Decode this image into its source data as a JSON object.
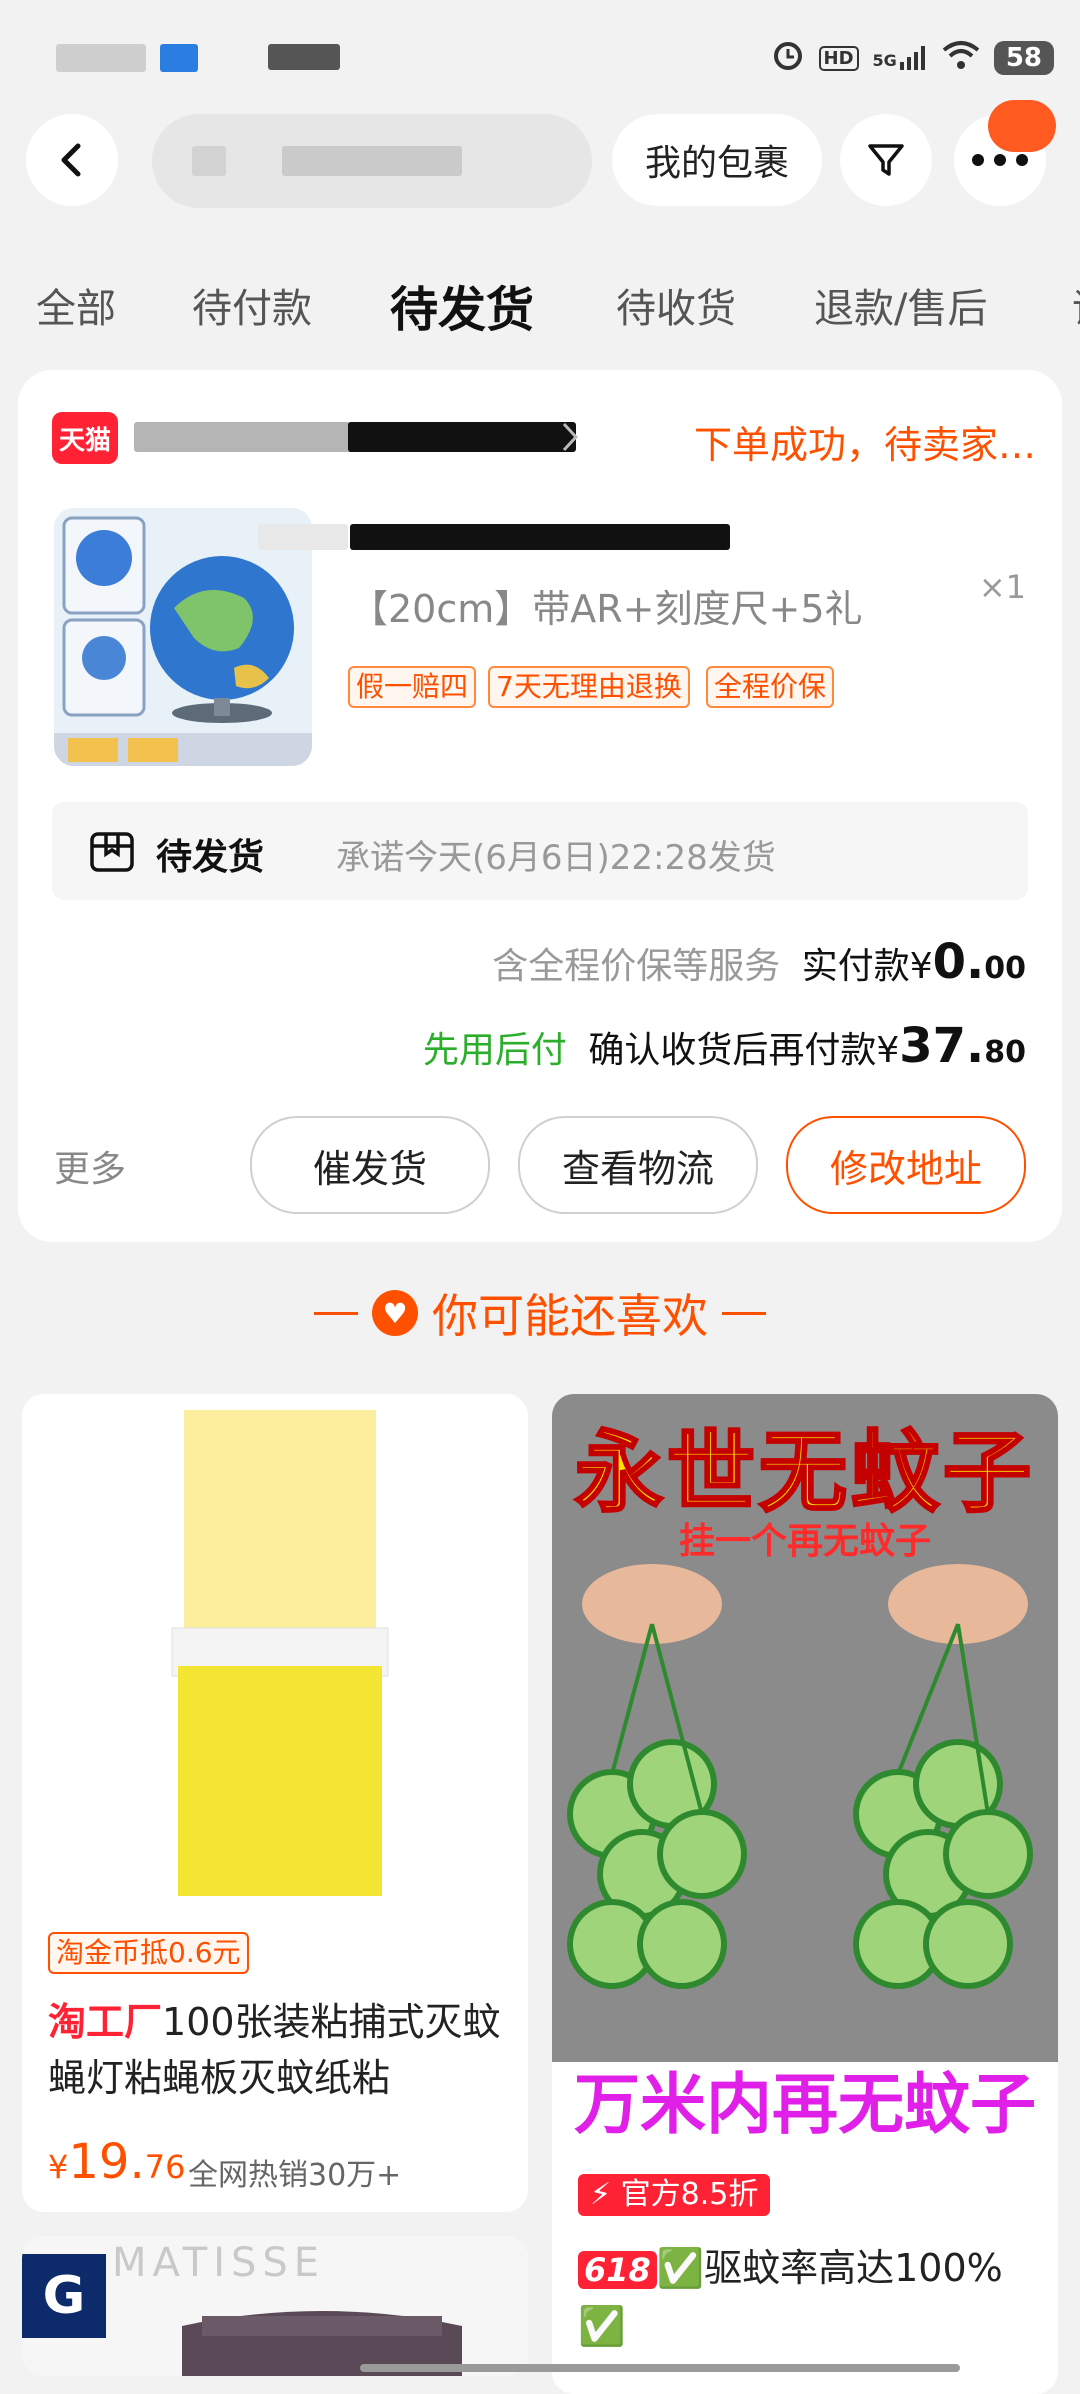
{
  "status_bar": {
    "battery": "58",
    "hd_label": "HD",
    "network": "5G"
  },
  "header": {
    "my_parcels_label": "我的包裹"
  },
  "tabs": [
    {
      "label": "全部"
    },
    {
      "label": "待付款"
    },
    {
      "label": "待发货"
    },
    {
      "label": "待收货"
    },
    {
      "label": "退款/售后"
    },
    {
      "label": "评"
    }
  ],
  "order": {
    "store_badge": "天猫",
    "status": "下单成功，待卖家…",
    "product_spec": "【20cm】带AR+刻度尺+5礼",
    "quantity": "×1",
    "tags": [
      "假一赔四",
      "7天无理由退换",
      "全程价保"
    ],
    "ship_label": "待发货",
    "ship_promise": "承诺今天(6月6日)22:28发货",
    "paid_prefix": "含全程价保等服务",
    "paid_label": "实付款¥",
    "paid_int": "0.",
    "paid_dec": "00",
    "bnpl_label": "先用后付",
    "confirm_pay_label": "确认收货后再付款¥",
    "confirm_int": "37.",
    "confirm_dec": "80",
    "more_label": "更多",
    "btn_urge": "催发货",
    "btn_logistics": "查看物流",
    "btn_address": "修改地址"
  },
  "recommend": {
    "title": "你可能还喜欢",
    "items": [
      {
        "coupon": "淘金币抵0.6元",
        "brand": "淘工厂",
        "title": "100张装粘捕式灭蚊蝇灯粘蝇板灭蚊纸粘",
        "price_symbol": "¥",
        "price_int": "19.",
        "price_dec": "76",
        "sales": "全网热销30万+"
      },
      {
        "poster_title": "永世无蚊子",
        "poster_sub": "挂一个再无蚊子",
        "poster_bottom": "万米内再无蚊子",
        "discount": "官方8.5折",
        "badge_618": "618",
        "title": "✅驱蚊率高达100% ✅"
      },
      {
        "brand_letter": "G",
        "print_text": "MATISSE"
      }
    ]
  },
  "colors": {
    "accent": "#ff5000",
    "tmall_red": "#ff2235",
    "bnpl_green": "#2bae2b"
  }
}
